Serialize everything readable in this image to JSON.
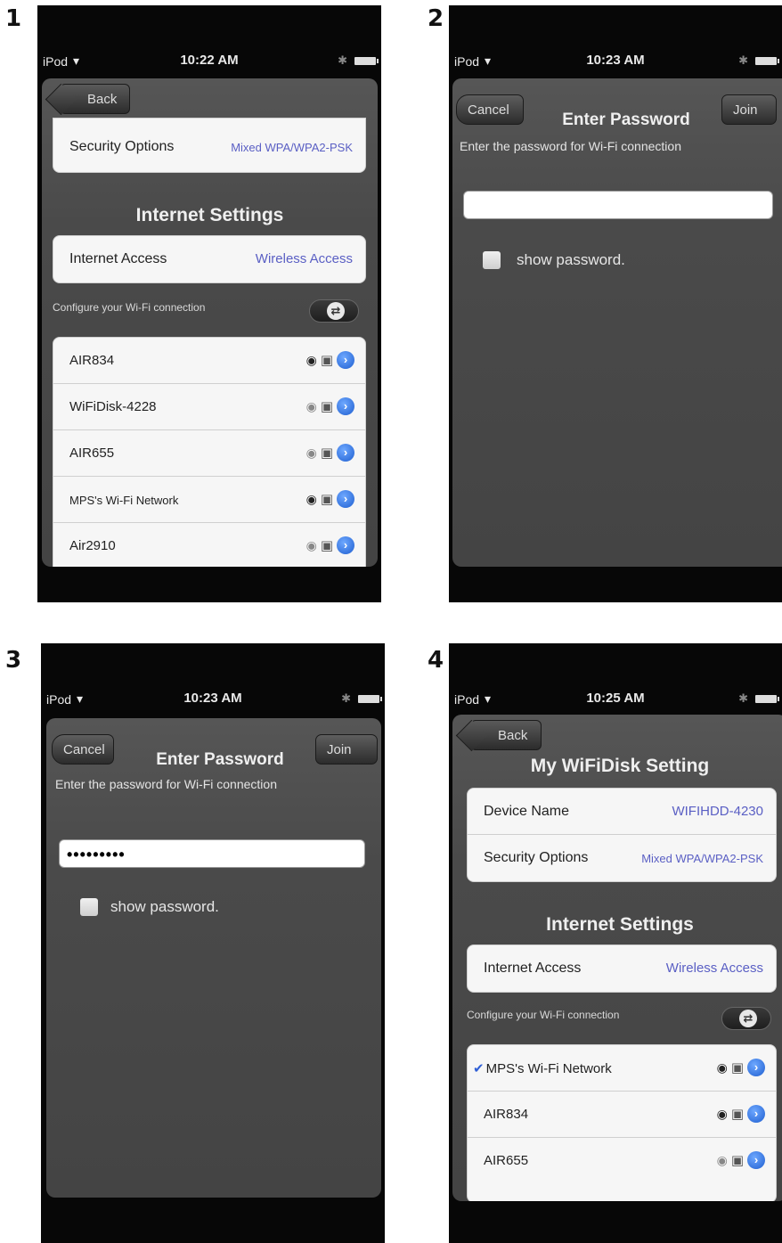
{
  "step_numbers": [
    "1",
    "2",
    "3",
    "4"
  ],
  "status": {
    "carrier": "iPod",
    "times": [
      "10:22 AM",
      "10:23 AM",
      "10:23 AM",
      "10:25 AM"
    ]
  },
  "icons": {
    "wifi": "wifi-icon",
    "lock": "lock-icon",
    "info": "info-chevron-icon",
    "bluetooth": "bluetooth-icon",
    "battery": "battery-icon",
    "refresh": "refresh-icon",
    "checkmark": "checkmark-icon"
  },
  "screen1": {
    "back_label": "Back",
    "security_options_label": "Security Options",
    "security_options_value": "Mixed WPA/WPA2-PSK",
    "section_title": "Internet Settings",
    "internet_access_label": "Internet Access",
    "internet_access_value": "Wireless Access",
    "configure_label": "Configure your Wi-Fi connection",
    "networks": [
      {
        "name": "AIR834",
        "signal": "strong"
      },
      {
        "name": "WiFiDisk-4228",
        "signal": "weak"
      },
      {
        "name": "AIR655",
        "signal": "weak"
      },
      {
        "name": "MPS's Wi-Fi Network",
        "signal": "strong"
      },
      {
        "name": "Air2910",
        "signal": "medium"
      }
    ]
  },
  "screen2": {
    "cancel_label": "Cancel",
    "title": "Enter Password",
    "join_label": "Join",
    "prompt": "Enter the password for Wi-Fi connection",
    "password_value": "",
    "show_password_label": "show password."
  },
  "screen3": {
    "cancel_label": "Cancel",
    "title": "Enter Password",
    "join_label": "Join",
    "prompt": "Enter the password for Wi-Fi connection",
    "password_value": "•••••••••",
    "show_password_label": "show password."
  },
  "screen4": {
    "back_label": "Back",
    "page_title": "My WiFiDisk Setting",
    "device_name_label": "Device Name",
    "device_name_value": "WIFIHDD-4230",
    "security_options_label": "Security Options",
    "security_options_value": "Mixed WPA/WPA2-PSK",
    "section_title": "Internet Settings",
    "internet_access_label": "Internet Access",
    "internet_access_value": "Wireless Access",
    "configure_label": "Configure your Wi-Fi connection",
    "networks": [
      {
        "name": "MPS's Wi-Fi Network",
        "signal": "strong",
        "selected": true
      },
      {
        "name": "AIR834",
        "signal": "strong",
        "selected": false
      },
      {
        "name": "AIR655",
        "signal": "weak",
        "selected": false
      }
    ]
  }
}
